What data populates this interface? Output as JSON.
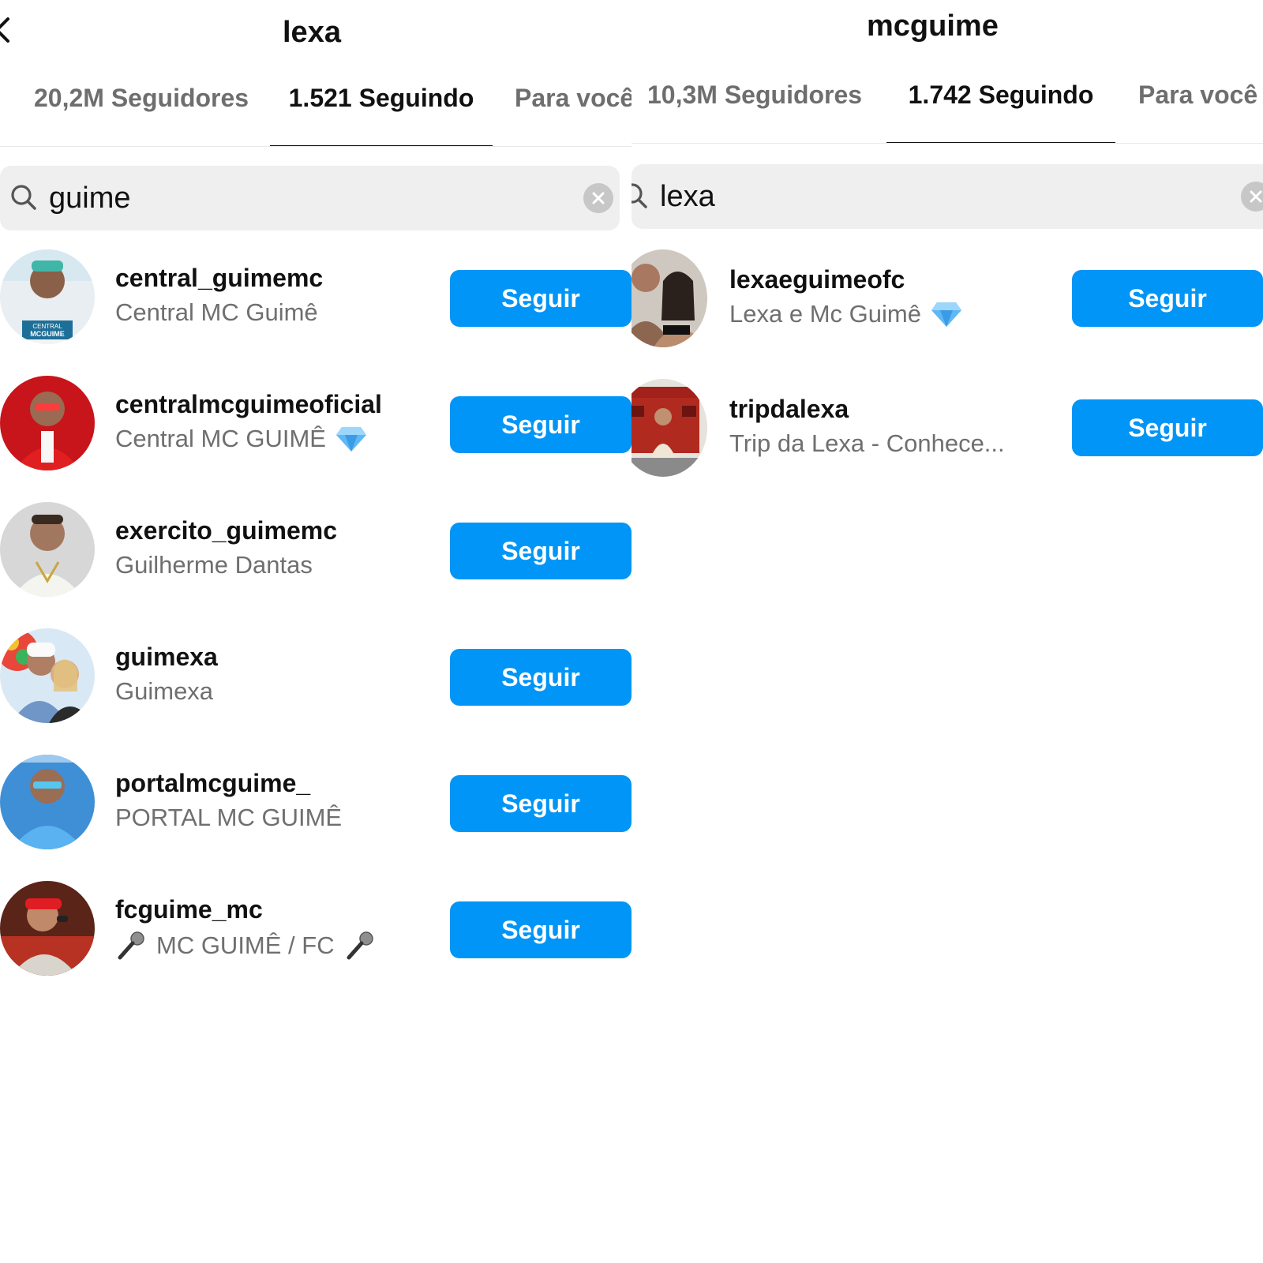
{
  "left_panel": {
    "title": "lexa",
    "tabs": [
      "20,2M Seguidores",
      "1.521 Seguindo",
      "Para você"
    ],
    "search": {
      "value": "guime"
    },
    "results": [
      {
        "username": "central_guimemc",
        "fullname": "Central MC Guimê",
        "button": "Seguir"
      },
      {
        "username": "centralmcguimeoficial",
        "fullname": "Central MC GUIMÊ",
        "button": "Seguir"
      },
      {
        "username": "exercito_guimemc",
        "fullname": "Guilherme Dantas",
        "button": "Seguir"
      },
      {
        "username": "guimexa",
        "fullname": "Guimexa",
        "button": "Seguir"
      },
      {
        "username": "portalmcguime_",
        "fullname": "PORTAL MC GUIMÊ",
        "button": "Seguir"
      },
      {
        "username": "fcguime_mc",
        "fullname": "MC GUIMÊ / FC",
        "button": "Seguir"
      }
    ],
    "avatar_text": {
      "line1": "CENTRAL",
      "line2": "MCGUIME"
    }
  },
  "right_panel": {
    "title": "mcguime",
    "tabs": [
      "10,3M Seguidores",
      "1.742 Seguindo",
      "Para você"
    ],
    "search": {
      "value": "lexa"
    },
    "results": [
      {
        "username": "lexaeguimeofc",
        "fullname": "Lexa e Mc Guimê",
        "button": "Seguir"
      },
      {
        "username": "tripdalexa",
        "fullname": "Trip da Lexa - Conhece...",
        "button": "Seguir"
      }
    ]
  },
  "colors": {
    "follow_button": "#0095f6",
    "search_bg": "#efefef",
    "secondary_text": "#6f6f6f"
  },
  "icons": [
    "chevron-left-icon",
    "search-icon",
    "clear-icon",
    "diamond-icon",
    "microphone-icon"
  ]
}
